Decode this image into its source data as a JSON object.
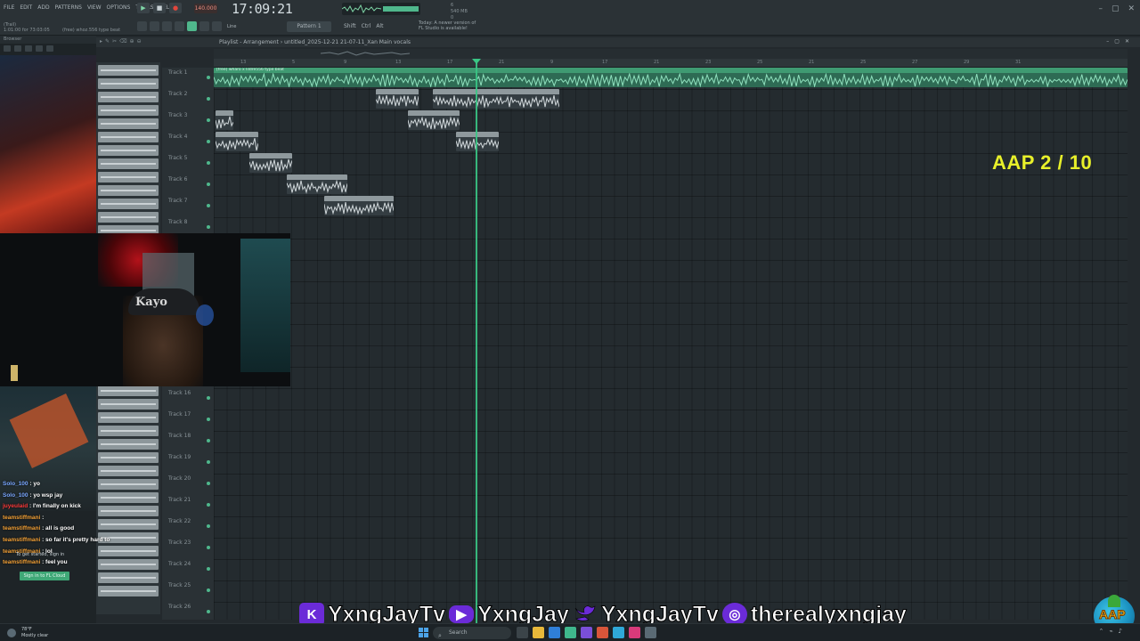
{
  "menu": [
    "FILE",
    "EDIT",
    "ADD",
    "PATTERNS",
    "VIEW",
    "OPTIONS",
    "TOOLS",
    "HELP"
  ],
  "transport": {
    "tempo": "140.000",
    "clock": "17:09:21",
    "time_sig": "3:2",
    "cpu_line1": "6",
    "cpu_line2": "540 MB",
    "cpu_line3": "0"
  },
  "hint": {
    "line1": "(Trail)",
    "line2": "1:01:00 for 73:03:05",
    "line3": "(free) whoz.556 type beat"
  },
  "toolbar": {
    "snap": "Line",
    "pattern": "Pattern 1",
    "keys": [
      "Shift",
      "Ctrl",
      "Alt"
    ]
  },
  "news": {
    "line1": "Today:  A newer version of",
    "line2": "FL Studio is available!"
  },
  "browser": {
    "title": "Browser"
  },
  "playlist": {
    "title": "Playlist - Arrangement  › untitled_2025-12-21 21-07-11_Xan Main vocals",
    "ruler": [
      "13",
      "5",
      "9",
      "13",
      "17",
      "21",
      "9",
      "17",
      "21",
      "23",
      "25",
      "21",
      "25",
      "27",
      "29",
      "31"
    ],
    "tracks": [
      "Track 1",
      "Track 2",
      "Track 3",
      "Track 4",
      "Track 5",
      "Track 6",
      "Track 7",
      "Track 8",
      "Track 16",
      "Track 17",
      "Track 18",
      "Track 19",
      "Track 20",
      "Track 21",
      "Track 22",
      "Track 23",
      "Track 24",
      "Track 25",
      "Track 26"
    ],
    "main_clip_label": "[free] wharo x lildre556 type beat"
  },
  "overlay": {
    "score": "AAP 2 / 10"
  },
  "webcam": {
    "hat_text": "Kayo"
  },
  "chat": [
    {
      "user": "Solo_100",
      "sep": " : ",
      "text": "yo",
      "cls": "u-solo"
    },
    {
      "user": "Solo_100",
      "sep": " : ",
      "text": "yo wsp jay",
      "cls": "u-solo"
    },
    {
      "user": "juyeulaid",
      "sep": " : ",
      "text": "I'm finally on kick",
      "cls": "u-red"
    },
    {
      "user": "teamstiffmani",
      "sep": " : ",
      "text": "",
      "cls": "u-team"
    },
    {
      "user": "teamstiffmani",
      "sep": " : ",
      "text": "all is good",
      "cls": "u-team"
    },
    {
      "user": "teamstiffmani",
      "sep": " : ",
      "text": "so far it's pretty hard to",
      "cls": "u-team"
    },
    {
      "user": "teamstiffmani",
      "sep": " : ",
      "text": "lol",
      "cls": "u-team"
    },
    {
      "user": "teamstiffmani",
      "sep": " : ",
      "text": "feel you",
      "cls": "u-team"
    }
  ],
  "signin": {
    "text": "To get started, sign in",
    "button": "Sign in to FL Cloud"
  },
  "socials": {
    "kick": "YxngJayTv",
    "youtube": "YxngJay",
    "twitter": "YxngJayTv",
    "instagram": "therealyxngjay"
  },
  "logo_text": "AAP",
  "taskbar": {
    "temp": "78°F",
    "weather": "Mostly clear",
    "search": "Search"
  },
  "colors": {
    "accent": "#4fb78c",
    "playhead": "#3ac685",
    "score": "#e8f02a",
    "brand_purple": "#6b2bd8"
  }
}
